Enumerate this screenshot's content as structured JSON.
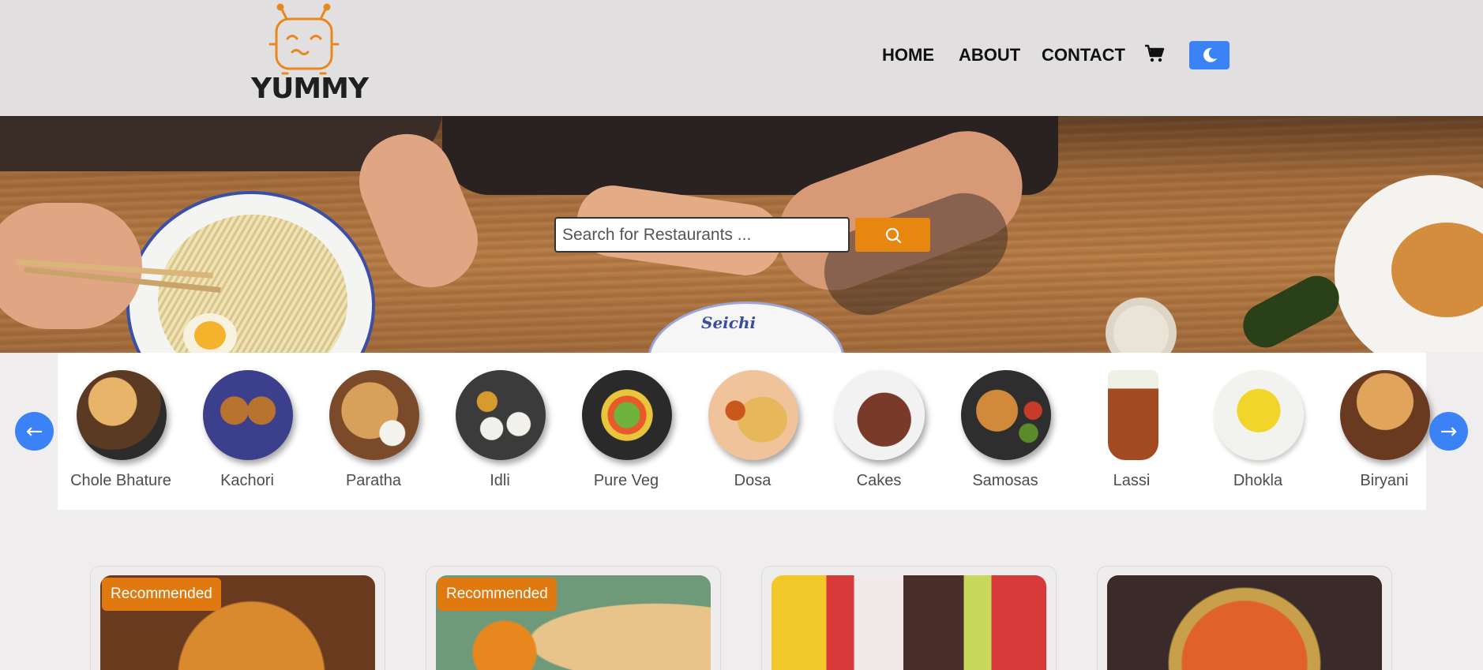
{
  "brand": {
    "name": "YUMMY",
    "accent": "#e8870f",
    "primary": "#3b82f6"
  },
  "nav": {
    "home": "HOME",
    "about": "ABOUT",
    "contact": "CONTACT"
  },
  "icons": {
    "cart": "cart-icon",
    "theme": "moon-icon",
    "search": "search-icon"
  },
  "hero": {
    "bowl_text": "Seichi"
  },
  "search": {
    "placeholder": "Search for Restaurants ..."
  },
  "categories": [
    {
      "label": "Chole Bhature"
    },
    {
      "label": "Kachori"
    },
    {
      "label": "Paratha"
    },
    {
      "label": "Idli"
    },
    {
      "label": "Pure Veg"
    },
    {
      "label": "Dosa"
    },
    {
      "label": "Cakes"
    },
    {
      "label": "Samosas"
    },
    {
      "label": "Lassi"
    },
    {
      "label": "Dhokla"
    },
    {
      "label": "Biryani"
    }
  ],
  "carousel": {
    "prev": "←",
    "next": "→"
  },
  "restaurants": [
    {
      "badge": "Recommended",
      "image": "pizza"
    },
    {
      "badge": "Recommended",
      "image": "dosa"
    },
    {
      "badge": "",
      "image": "desserts"
    },
    {
      "badge": "",
      "image": "paneer-curry"
    }
  ]
}
